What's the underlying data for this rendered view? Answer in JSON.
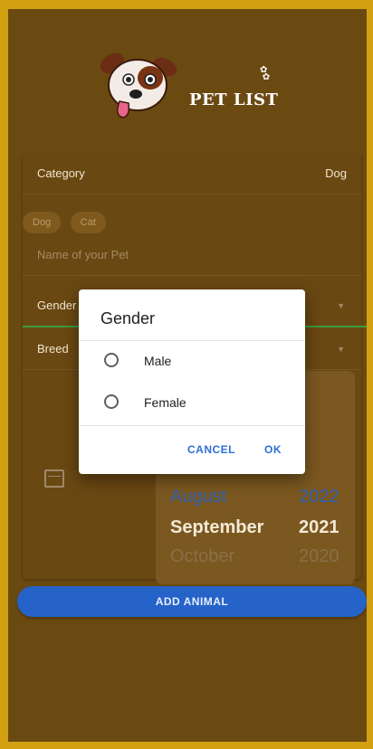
{
  "app": {
    "logo_text": "PET LIST"
  },
  "form": {
    "category_label": "Category",
    "category_value": "Dog",
    "chips": [
      "Dog",
      "Cat"
    ],
    "name_placeholder": "Name of your Pet",
    "gender_label": "Gender",
    "breed_label": "Breed",
    "date_wheel": {
      "months": [
        "August",
        "September",
        "October"
      ],
      "years": [
        "2022",
        "2021",
        "2020"
      ]
    },
    "add_button": "ADD ANIMAL"
  },
  "dialog": {
    "title": "Gender",
    "options": [
      "Male",
      "Female"
    ],
    "cancel": "CANCEL",
    "ok": "OK"
  }
}
